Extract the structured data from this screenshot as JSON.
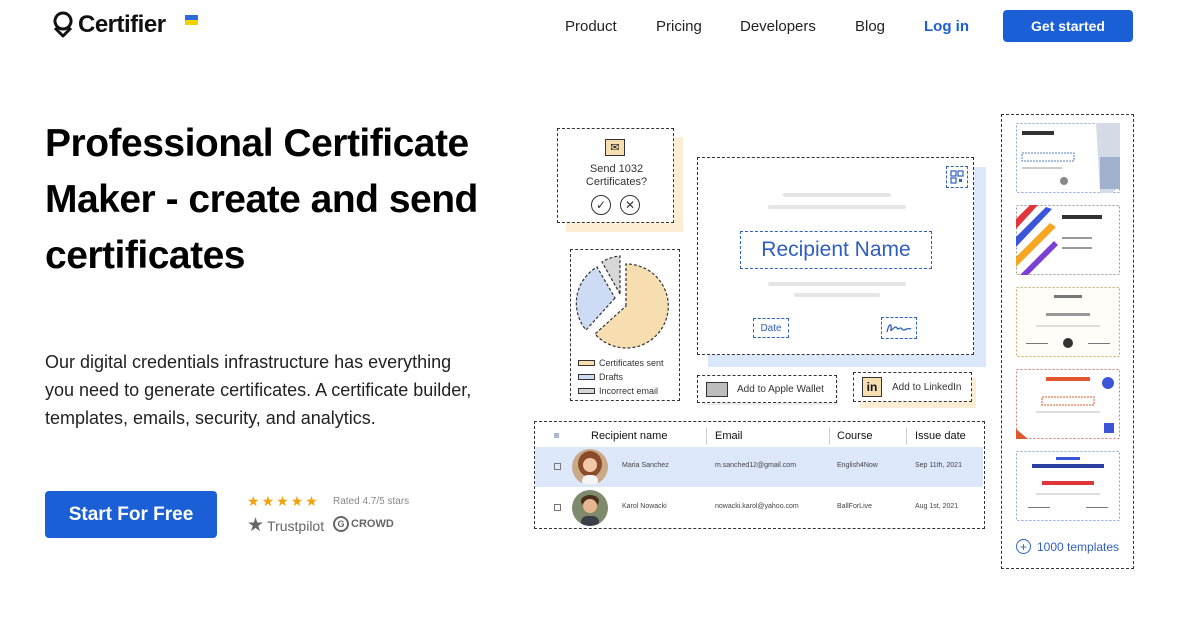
{
  "header": {
    "brand": "Certifier",
    "nav": [
      "Product",
      "Pricing",
      "Developers",
      "Blog"
    ],
    "login_label": "Log in",
    "cta_label": "Get started"
  },
  "hero": {
    "title": "Professional Certificate Maker - create and send certificates",
    "description": "Our digital credentials infrastructure has everything you need to generate certificates. A certificate builder, templates, emails, security, and analytics.",
    "cta_label": "Start For Free",
    "rating_text": "Rated 4.7/5 stars",
    "stars": 5,
    "trustpilot": "Trustpilot",
    "g2_mark": "G",
    "g2_label": "CROWD"
  },
  "illustration": {
    "send_card": {
      "text": "Send 1032 Certificates?"
    },
    "pie_legend": [
      "Certificates sent",
      "Drafts",
      "Incorrect email"
    ],
    "certificate": {
      "recipient_placeholder": "Recipient Name",
      "date_label": "Date"
    },
    "apple_wallet_label": "Add to Apple Wallet",
    "linkedin_label": "Add to LinkedIn",
    "linkedin_mark": "in",
    "table": {
      "columns": [
        "Recipient name",
        "Email",
        "Course",
        "Issue date"
      ],
      "rows": [
        {
          "name": "Maria Sanchez",
          "email": "m.sanched12@gmail.com",
          "course": "English4Now",
          "date": "Sep 11th, 2021"
        },
        {
          "name": "Karol Nowacki",
          "email": "nowacki.karol@yahoo.com",
          "course": "BallForLive",
          "date": "Aug 1st, 2021"
        }
      ]
    },
    "templates_label": "1000 templates"
  },
  "colors": {
    "brand_blue": "#1a5fd6",
    "accent_yellow": "#f6deb0",
    "accent_light_blue": "#dce7fa",
    "star_orange": "#f2a10b"
  }
}
